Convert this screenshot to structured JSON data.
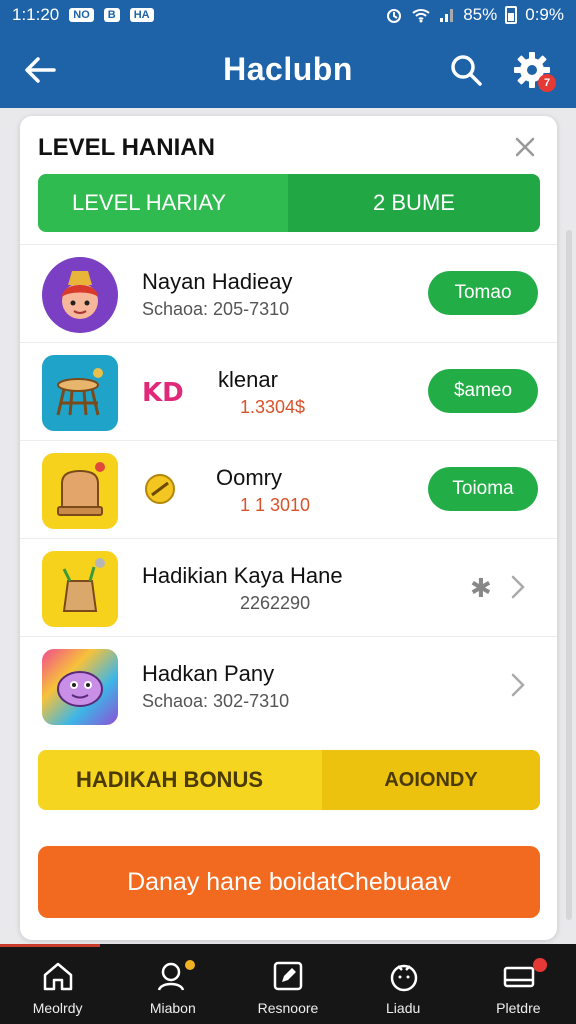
{
  "status_bar": {
    "time": "1:1:20",
    "chip1": "NO",
    "chip2": "B",
    "chip3": "HA",
    "battery_text": "85%",
    "clock_right": "0:9%"
  },
  "app_bar": {
    "title": "Haclubn"
  },
  "card": {
    "title": "LEVEL HANIAN",
    "level_bar": {
      "left": "LEVEL HARIAY",
      "right": "2 BUME"
    },
    "items": [
      {
        "name": "Nayan Hadieay",
        "sub": "Schaoa: 205-7310",
        "action": "Tomao"
      },
      {
        "name": "klenar",
        "sub": "1.3304$",
        "action": "$ameo",
        "prefix": "KD"
      },
      {
        "name": "Oomry",
        "sub": "1 1 3010",
        "action": "Toioma"
      },
      {
        "name": "Hadikian Kaya Hane",
        "sub": "2262290"
      },
      {
        "name": "Hadkan Pany",
        "sub": "Schaoa: 302-7310"
      }
    ],
    "bonus": {
      "left": "HADIKAH BONUS",
      "right": "AOIONDY"
    },
    "cta": "Danay hane boidatChebuaav"
  },
  "bottom_nav": [
    {
      "label": "Meolrdy"
    },
    {
      "label": "Miabon"
    },
    {
      "label": "Resnoore"
    },
    {
      "label": "Liadu"
    },
    {
      "label": "Pletdre"
    }
  ],
  "colors": {
    "primary": "#1e63a8",
    "green": "#2fbb4f",
    "yellow": "#f5d51f",
    "orange": "#f16a1f"
  }
}
